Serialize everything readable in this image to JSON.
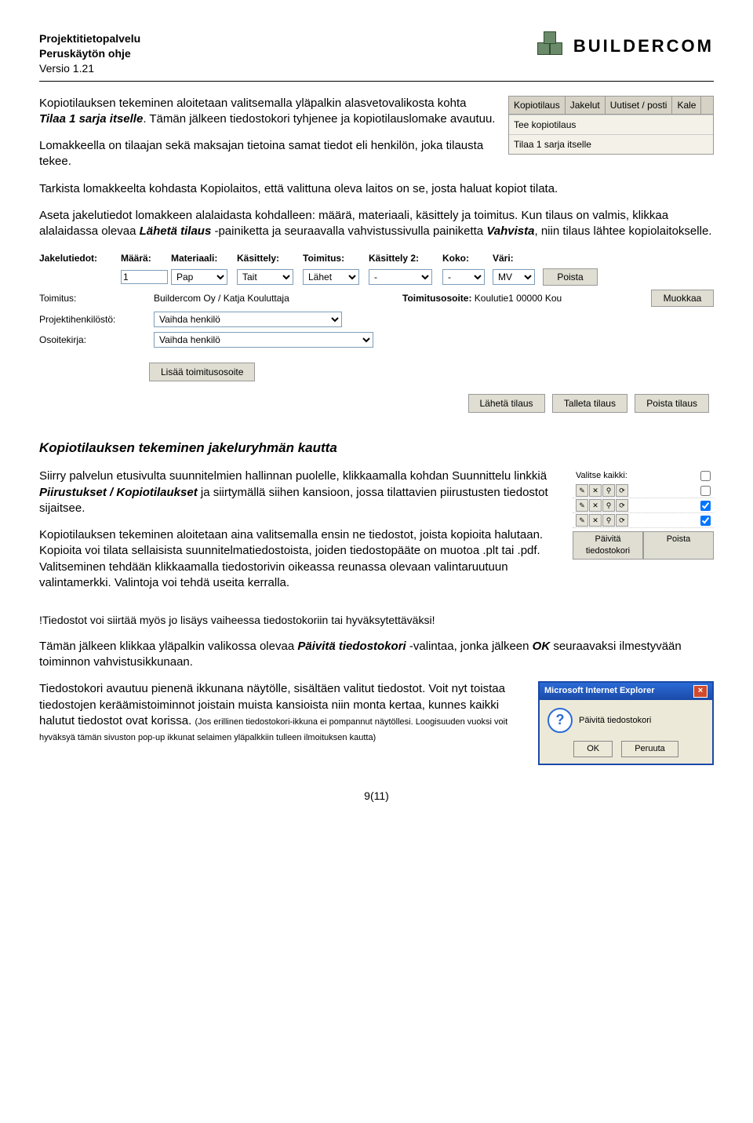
{
  "header": {
    "line1": "Projektitietopalvelu",
    "line2": "Peruskäytön ohje",
    "line3": "Versio 1.21",
    "logo_text": "BUILDERCOM"
  },
  "para1_pre": "Kopiotilauksen tekeminen aloitetaan valitsemalla yläpalkin alasvetovalikosta kohta ",
  "para1_em": "Tilaa 1 sarja itselle",
  "para1_post": ". Tämän jälkeen tiedostokori tyhjenee ja kopiotilauslomake avautuu.",
  "para2": "Lomakkeella on tilaajan sekä maksajan tietoina samat tiedot eli henkilön, joka tilausta tekee.",
  "para3": "Tarkista lomakkeelta kohdasta Kopiolaitos, että valittuna oleva laitos on se, josta haluat kopiot tilata.",
  "para4_a": "Aseta jakelutiedot lomakkeen alalaidasta kohdalleen: määrä, materiaali, käsittely ja toimitus. Kun tilaus on valmis, klikkaa alalaidassa olevaa ",
  "para4_em1": "Lähetä tilaus",
  "para4_b": " -painiketta ja seuraavalla vahvistussivulla painiketta ",
  "para4_em2": "Vahvista",
  "para4_c": ", niin tilaus lähtee kopiolaitokselle.",
  "menu": {
    "tabs": [
      "Kopiotilaus",
      "Jakelut",
      "Uutiset / posti",
      "Kale"
    ],
    "items": [
      "Tee kopiotilaus",
      "Tilaa 1 sarja itselle"
    ]
  },
  "form": {
    "headers": [
      "Jakelutiedot:",
      "Määrä:",
      "Materiaali:",
      "Käsittely:",
      "Toimitus:",
      "Käsittely 2:",
      "Koko:",
      "Väri:",
      ""
    ],
    "values": [
      "",
      "1",
      "Pap",
      "Tait",
      "Lähet",
      "-",
      "-",
      "MV",
      "Poista"
    ],
    "row_toim": {
      "label": "Toimitus:",
      "value": "Buildercom Oy / Katja Kouluttaja",
      "osoite_label": "Toimitusosoite:",
      "osoite_val": "Koulutie1 00000 Kou",
      "btn": "Muokkaa"
    },
    "row_proj": {
      "label": "Projektihenkilöstö:",
      "value": "Vaihda henkilö"
    },
    "row_addr": {
      "label": "Osoitekirja:",
      "value": "Vaihda henkilö"
    },
    "btn_add": "Lisää toimitusosoite",
    "btn_send": "Lähetä tilaus",
    "btn_save": "Talleta tilaus",
    "btn_del": "Poista tilaus"
  },
  "sec2_title": "Kopiotilauksen tekeminen jakeluryhmän kautta",
  "sec2_p1_a": "Siirry palvelun etusivulta suunnitelmien hallinnan puolelle, klikkaamalla kohdan Suunnittelu linkkiä ",
  "sec2_p1_em": "Piirustukset / Kopiotilaukset",
  "sec2_p1_b": " ja siirtymällä siihen kansioon, jossa tilattavien piirustusten tiedostot sijaitsee.",
  "sec2_p2": "Kopiotilauksen tekeminen aloitetaan aina valitsemalla ensin ne tiedostot, joista kopioita halutaan. Kopioita voi tilata sellaisista suunnitelmatiedostoista, joiden tiedostopääte on muotoa .plt tai .pdf. Valitseminen tehdään klikkaamalla tiedostorivin oikeassa reunassa olevaan valintaruutuun valintamerkki. Valintoja voi tehdä useita kerralla.",
  "files": {
    "top": "Valitse kaikki:",
    "btn_refresh": "Päivitä tiedostokori",
    "btn_del": "Poista"
  },
  "sec2_note": "!Tiedostot voi siirtää myös jo lisäys vaiheessa tiedostokoriin tai hyväksytettäväksi!",
  "sec2_p3_a": "Tämän jälkeen klikkaa yläpalkin valikossa olevaa ",
  "sec2_p3_em": "Päivitä tiedostokori",
  "sec2_p3_b": " -valintaa, jonka jälkeen ",
  "sec2_p3_ok": "OK",
  "sec2_p3_c": " seuraavaksi ilmestyvään toiminnon vahvistusikkunaan.",
  "sec2_p4_a": "Tiedostokori avautuu pienenä ikkunana näytölle, sisältäen valitut tiedostot. Voit nyt toistaa tiedostojen keräämistoiminnot joistain muista kansioista niin monta kertaa, kunnes kaikki halutut tiedostot ovat korissa. ",
  "sec2_p4_tiny": "(Jos erillinen tiedostokori-ikkuna ei pompannut näytöllesi. Loogisuuden vuoksi voit hyväksyä tämän sivuston pop-up ikkunat selaimen yläpalkkiin tulleen ilmoituksen kautta)",
  "dialog": {
    "title": "Microsoft Internet Explorer",
    "msg": "Päivitä tiedostokori",
    "ok": "OK",
    "cancel": "Peruuta"
  },
  "page_num": "9(11)"
}
